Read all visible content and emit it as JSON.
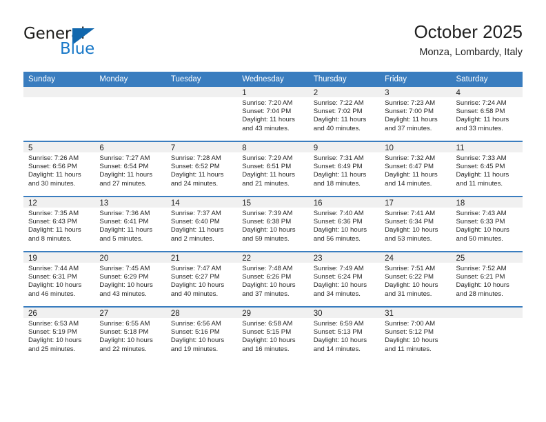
{
  "brand": {
    "name_part1": "General",
    "name_part2": "Blue",
    "accent_color": "#1167ad",
    "text_color": "#1d1d1b"
  },
  "header": {
    "title": "October 2025",
    "location": "Monza, Lombardy, Italy",
    "header_bg": "#3a7dbf"
  },
  "weekday_headers": [
    "Sunday",
    "Monday",
    "Tuesday",
    "Wednesday",
    "Thursday",
    "Friday",
    "Saturday"
  ],
  "weeks": [
    [
      {
        "day": "",
        "sunrise": "",
        "sunset": "",
        "daylight_line1": "",
        "daylight_line2": "",
        "empty": true
      },
      {
        "day": "",
        "sunrise": "",
        "sunset": "",
        "daylight_line1": "",
        "daylight_line2": "",
        "empty": true
      },
      {
        "day": "",
        "sunrise": "",
        "sunset": "",
        "daylight_line1": "",
        "daylight_line2": "",
        "empty": true
      },
      {
        "day": "1",
        "sunrise": "Sunrise: 7:20 AM",
        "sunset": "Sunset: 7:04 PM",
        "daylight_line1": "Daylight: 11 hours",
        "daylight_line2": "and 43 minutes.",
        "empty": false
      },
      {
        "day": "2",
        "sunrise": "Sunrise: 7:22 AM",
        "sunset": "Sunset: 7:02 PM",
        "daylight_line1": "Daylight: 11 hours",
        "daylight_line2": "and 40 minutes.",
        "empty": false
      },
      {
        "day": "3",
        "sunrise": "Sunrise: 7:23 AM",
        "sunset": "Sunset: 7:00 PM",
        "daylight_line1": "Daylight: 11 hours",
        "daylight_line2": "and 37 minutes.",
        "empty": false
      },
      {
        "day": "4",
        "sunrise": "Sunrise: 7:24 AM",
        "sunset": "Sunset: 6:58 PM",
        "daylight_line1": "Daylight: 11 hours",
        "daylight_line2": "and 33 minutes.",
        "empty": false
      }
    ],
    [
      {
        "day": "5",
        "sunrise": "Sunrise: 7:26 AM",
        "sunset": "Sunset: 6:56 PM",
        "daylight_line1": "Daylight: 11 hours",
        "daylight_line2": "and 30 minutes.",
        "empty": false
      },
      {
        "day": "6",
        "sunrise": "Sunrise: 7:27 AM",
        "sunset": "Sunset: 6:54 PM",
        "daylight_line1": "Daylight: 11 hours",
        "daylight_line2": "and 27 minutes.",
        "empty": false
      },
      {
        "day": "7",
        "sunrise": "Sunrise: 7:28 AM",
        "sunset": "Sunset: 6:52 PM",
        "daylight_line1": "Daylight: 11 hours",
        "daylight_line2": "and 24 minutes.",
        "empty": false
      },
      {
        "day": "8",
        "sunrise": "Sunrise: 7:29 AM",
        "sunset": "Sunset: 6:51 PM",
        "daylight_line1": "Daylight: 11 hours",
        "daylight_line2": "and 21 minutes.",
        "empty": false
      },
      {
        "day": "9",
        "sunrise": "Sunrise: 7:31 AM",
        "sunset": "Sunset: 6:49 PM",
        "daylight_line1": "Daylight: 11 hours",
        "daylight_line2": "and 18 minutes.",
        "empty": false
      },
      {
        "day": "10",
        "sunrise": "Sunrise: 7:32 AM",
        "sunset": "Sunset: 6:47 PM",
        "daylight_line1": "Daylight: 11 hours",
        "daylight_line2": "and 14 minutes.",
        "empty": false
      },
      {
        "day": "11",
        "sunrise": "Sunrise: 7:33 AM",
        "sunset": "Sunset: 6:45 PM",
        "daylight_line1": "Daylight: 11 hours",
        "daylight_line2": "and 11 minutes.",
        "empty": false
      }
    ],
    [
      {
        "day": "12",
        "sunrise": "Sunrise: 7:35 AM",
        "sunset": "Sunset: 6:43 PM",
        "daylight_line1": "Daylight: 11 hours",
        "daylight_line2": "and 8 minutes.",
        "empty": false
      },
      {
        "day": "13",
        "sunrise": "Sunrise: 7:36 AM",
        "sunset": "Sunset: 6:41 PM",
        "daylight_line1": "Daylight: 11 hours",
        "daylight_line2": "and 5 minutes.",
        "empty": false
      },
      {
        "day": "14",
        "sunrise": "Sunrise: 7:37 AM",
        "sunset": "Sunset: 6:40 PM",
        "daylight_line1": "Daylight: 11 hours",
        "daylight_line2": "and 2 minutes.",
        "empty": false
      },
      {
        "day": "15",
        "sunrise": "Sunrise: 7:39 AM",
        "sunset": "Sunset: 6:38 PM",
        "daylight_line1": "Daylight: 10 hours",
        "daylight_line2": "and 59 minutes.",
        "empty": false
      },
      {
        "day": "16",
        "sunrise": "Sunrise: 7:40 AM",
        "sunset": "Sunset: 6:36 PM",
        "daylight_line1": "Daylight: 10 hours",
        "daylight_line2": "and 56 minutes.",
        "empty": false
      },
      {
        "day": "17",
        "sunrise": "Sunrise: 7:41 AM",
        "sunset": "Sunset: 6:34 PM",
        "daylight_line1": "Daylight: 10 hours",
        "daylight_line2": "and 53 minutes.",
        "empty": false
      },
      {
        "day": "18",
        "sunrise": "Sunrise: 7:43 AM",
        "sunset": "Sunset: 6:33 PM",
        "daylight_line1": "Daylight: 10 hours",
        "daylight_line2": "and 50 minutes.",
        "empty": false
      }
    ],
    [
      {
        "day": "19",
        "sunrise": "Sunrise: 7:44 AM",
        "sunset": "Sunset: 6:31 PM",
        "daylight_line1": "Daylight: 10 hours",
        "daylight_line2": "and 46 minutes.",
        "empty": false
      },
      {
        "day": "20",
        "sunrise": "Sunrise: 7:45 AM",
        "sunset": "Sunset: 6:29 PM",
        "daylight_line1": "Daylight: 10 hours",
        "daylight_line2": "and 43 minutes.",
        "empty": false
      },
      {
        "day": "21",
        "sunrise": "Sunrise: 7:47 AM",
        "sunset": "Sunset: 6:27 PM",
        "daylight_line1": "Daylight: 10 hours",
        "daylight_line2": "and 40 minutes.",
        "empty": false
      },
      {
        "day": "22",
        "sunrise": "Sunrise: 7:48 AM",
        "sunset": "Sunset: 6:26 PM",
        "daylight_line1": "Daylight: 10 hours",
        "daylight_line2": "and 37 minutes.",
        "empty": false
      },
      {
        "day": "23",
        "sunrise": "Sunrise: 7:49 AM",
        "sunset": "Sunset: 6:24 PM",
        "daylight_line1": "Daylight: 10 hours",
        "daylight_line2": "and 34 minutes.",
        "empty": false
      },
      {
        "day": "24",
        "sunrise": "Sunrise: 7:51 AM",
        "sunset": "Sunset: 6:22 PM",
        "daylight_line1": "Daylight: 10 hours",
        "daylight_line2": "and 31 minutes.",
        "empty": false
      },
      {
        "day": "25",
        "sunrise": "Sunrise: 7:52 AM",
        "sunset": "Sunset: 6:21 PM",
        "daylight_line1": "Daylight: 10 hours",
        "daylight_line2": "and 28 minutes.",
        "empty": false
      }
    ],
    [
      {
        "day": "26",
        "sunrise": "Sunrise: 6:53 AM",
        "sunset": "Sunset: 5:19 PM",
        "daylight_line1": "Daylight: 10 hours",
        "daylight_line2": "and 25 minutes.",
        "empty": false
      },
      {
        "day": "27",
        "sunrise": "Sunrise: 6:55 AM",
        "sunset": "Sunset: 5:18 PM",
        "daylight_line1": "Daylight: 10 hours",
        "daylight_line2": "and 22 minutes.",
        "empty": false
      },
      {
        "day": "28",
        "sunrise": "Sunrise: 6:56 AM",
        "sunset": "Sunset: 5:16 PM",
        "daylight_line1": "Daylight: 10 hours",
        "daylight_line2": "and 19 minutes.",
        "empty": false
      },
      {
        "day": "29",
        "sunrise": "Sunrise: 6:58 AM",
        "sunset": "Sunset: 5:15 PM",
        "daylight_line1": "Daylight: 10 hours",
        "daylight_line2": "and 16 minutes.",
        "empty": false
      },
      {
        "day": "30",
        "sunrise": "Sunrise: 6:59 AM",
        "sunset": "Sunset: 5:13 PM",
        "daylight_line1": "Daylight: 10 hours",
        "daylight_line2": "and 14 minutes.",
        "empty": false
      },
      {
        "day": "31",
        "sunrise": "Sunrise: 7:00 AM",
        "sunset": "Sunset: 5:12 PM",
        "daylight_line1": "Daylight: 10 hours",
        "daylight_line2": "and 11 minutes.",
        "empty": false
      },
      {
        "day": "",
        "sunrise": "",
        "sunset": "",
        "daylight_line1": "",
        "daylight_line2": "",
        "empty": true
      }
    ]
  ]
}
